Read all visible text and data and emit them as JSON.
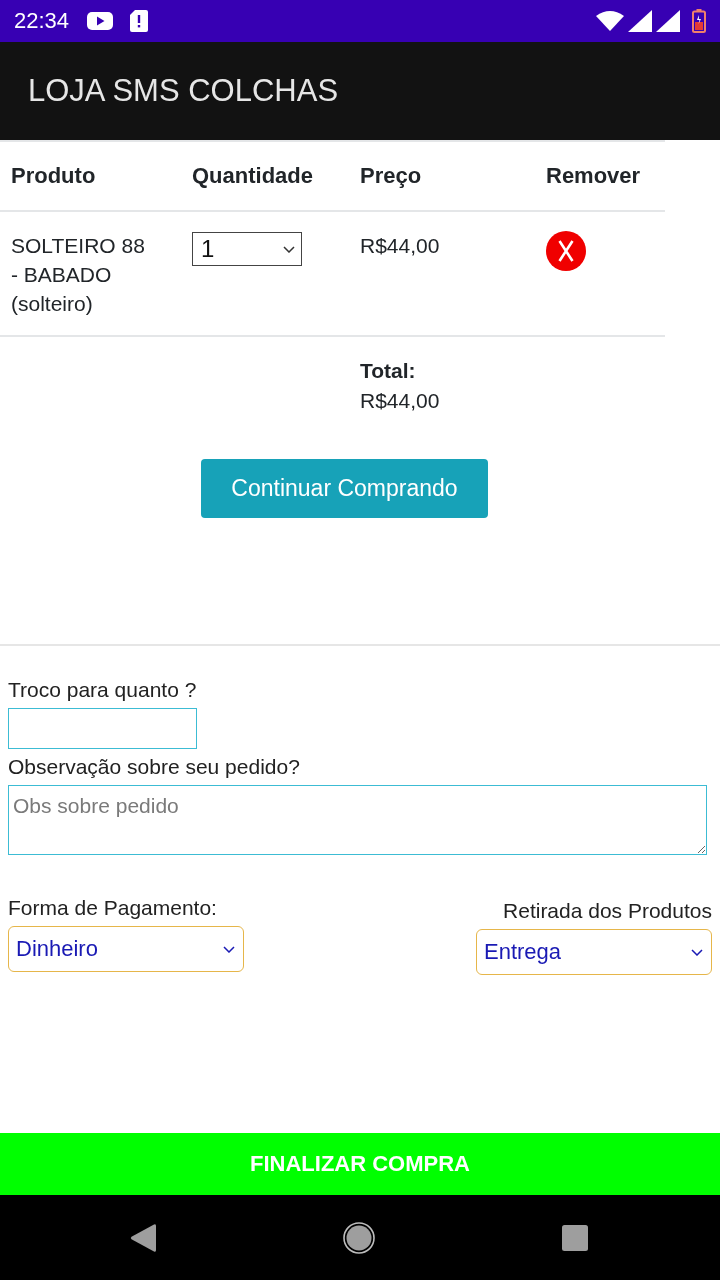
{
  "status_bar": {
    "time": "22:34"
  },
  "app_bar": {
    "title": "LOJA SMS COLCHAS"
  },
  "cart_table": {
    "columns": [
      "Produto",
      "Quantidade",
      "Preço",
      "Remover"
    ],
    "rows": [
      {
        "product": "SOLTEIRO 88 - BABADO (solteiro)",
        "quantity": "1",
        "price": "R$44,00"
      }
    ],
    "total_label": "Total:",
    "total_value": "R$44,00"
  },
  "continue_button": "Continuar Comprando",
  "form": {
    "change": {
      "label": "Troco para quanto ?"
    },
    "notes": {
      "label": "Observação sobre seu pedido?",
      "placeholder": "Obs sobre pedido"
    },
    "payment": {
      "label": "Forma de Pagamento:",
      "value": "Dinheiro"
    },
    "pickup": {
      "label": "Retirada dos Produtos",
      "value": "Entrega"
    }
  },
  "finish_button": "FINALIZAR COMPRA"
}
